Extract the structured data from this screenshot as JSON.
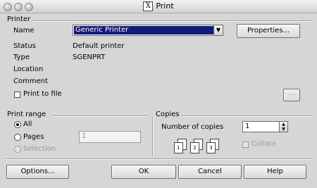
{
  "window": {
    "title": "Print",
    "app_icon": "X"
  },
  "printer": {
    "section_title": "Printer",
    "name_label": "Name",
    "name_value": "Generic Printer",
    "properties_button": "Properties...",
    "status_label": "Status",
    "status_value": "Default printer",
    "type_label": "Type",
    "type_value": "SGENPRT",
    "location_label": "Location",
    "comment_label": "Comment",
    "print_to_file_label": "Print to file",
    "browse_button": "..."
  },
  "print_range": {
    "section_title": "Print range",
    "options": [
      "All",
      "Pages",
      "Selection"
    ],
    "selected": "All",
    "pages_value": "1"
  },
  "copies": {
    "section_title": "Copies",
    "number_label": "Number of copies",
    "number_value": "1",
    "collate_label": "Collate",
    "page_numbers": [
      "1",
      "2",
      "3"
    ]
  },
  "buttons": {
    "options": "Options...",
    "ok": "OK",
    "cancel": "Cancel",
    "help": "Help"
  },
  "icons": {
    "spin_up": "▲",
    "spin_down": "▼",
    "dropdown": "▼"
  }
}
